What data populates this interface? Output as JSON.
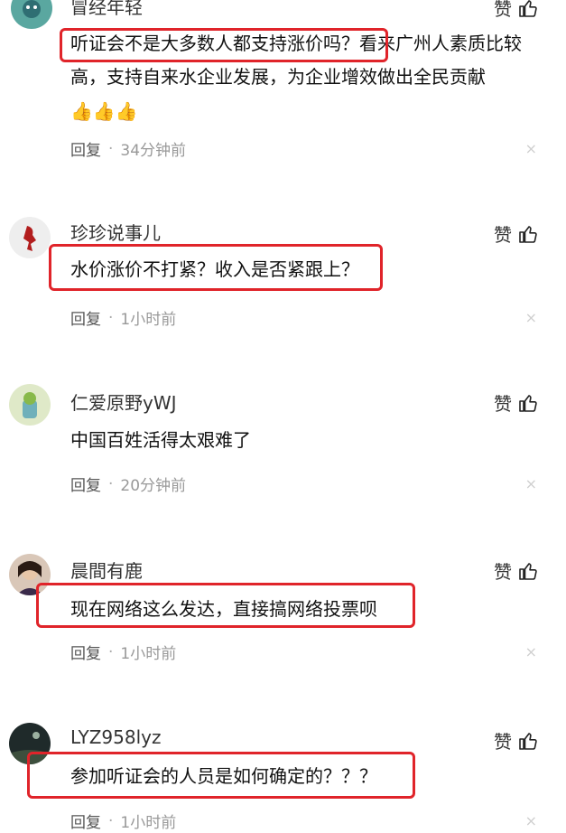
{
  "like_label": "赞",
  "comments": [
    {
      "username": "冒经年轻",
      "text": "听证会不是大多数人都支持涨价吗？看来广州人素质比较高，支持自来水企业发展，为企业增效做出全民贡献",
      "highlight": "听证会不是大多数人都支持涨价吗？",
      "emoji": "👍👍👍",
      "reply_label": "回复",
      "time": "34分钟前",
      "close": "×"
    },
    {
      "username": "珍珍说事儿",
      "text": "水价涨价不打紧？收入是否紧跟上？",
      "reply_label": "回复",
      "time": "1小时前",
      "close": "×"
    },
    {
      "username": "仁爱原野yWJ",
      "text": "中国百姓活得太艰难了",
      "reply_label": "回复",
      "time": "20分钟前",
      "close": "×"
    },
    {
      "username": "晨間有鹿",
      "text": "现在网络这么发达，直接搞网络投票呗",
      "reply_label": "回复",
      "time": "1小时前",
      "close": "×"
    },
    {
      "username": "LYZ958lyz",
      "text": "参加听证会的人员是如何确定的？？？",
      "reply_label": "回复",
      "time": "1小时前",
      "close": "×"
    }
  ],
  "colors": {
    "highlight": "#e0242a",
    "text": "#111111",
    "meta": "#999999"
  }
}
